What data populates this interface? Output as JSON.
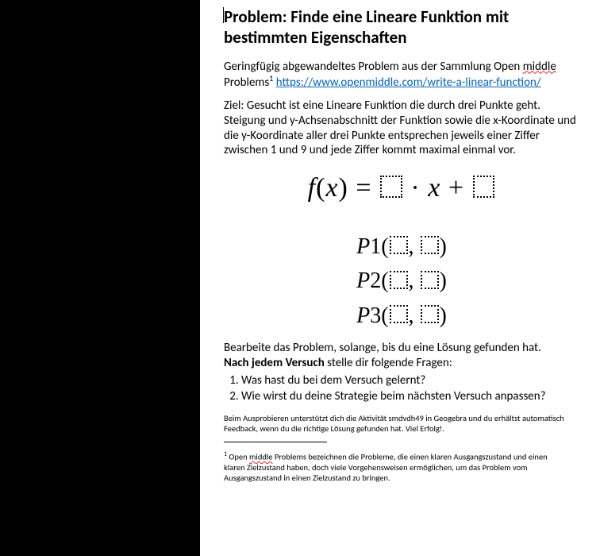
{
  "heading": "Problem: Finde eine Lineare Funktion mit bestimmten Eigenschaften",
  "intro": {
    "pre": "Geringfügig abgewandeltes Problem aus der Sammlung Open ",
    "sqg1": "middle",
    "post1": " Problems",
    "sup": "1",
    "space": " ",
    "url": "https://www.openmiddle.com/write-a-linear-function/"
  },
  "goal": "Ziel: Gesucht ist eine Lineare Funktion die durch drei Punkte geht. Steigung und y-Achsenabschnitt der Funktion sowie die x-Koordinate und die y-Koordinate aller drei Punkte entsprechen jeweils einer Ziffer zwischen 1 und 9  und jede Ziffer kommt maximal einmal vor.",
  "equation": {
    "fx_l": "f",
    "fx_paren_o": "(",
    "fx_x": "x",
    "fx_paren_c": ")",
    "eq": " = ",
    "dot": " · ",
    "x": "x",
    "plus": " + "
  },
  "points": {
    "p1": "P",
    "n1": "1",
    "p2": "P",
    "n2": "2",
    "p3": "P",
    "n3": "3",
    "open": "(",
    "comma": ", ",
    "close": ")"
  },
  "work": {
    "line1": "Bearbeite das Problem, solange, bis du eine Lösung gefunden hat.",
    "bold": "Nach jedem Versuch",
    "line2_rest": " stelle dir folgende Fragen:"
  },
  "questions": [
    "Was hast du bei dem Versuch gelernt?",
    "Wie wirst du deine Strategie beim nächsten Versuch anpassen?"
  ],
  "hint": "Beim Ausprobieren unterstützt dich die Aktivität smdvdh49 in Geogebra und du erhältst automatisch Feedback, wenn du die richtige Lösung gefunden hat. Viel Erfolg!.",
  "footnote": {
    "mark": "1",
    "pre": " Open ",
    "sqg": "middle",
    "rest": " Problems bezeichnen die Probleme, die einen klaren Ausgangszustand und einen klaren Zielzustand haben, doch viele Vorgehensweisen ermöglichen, um das Problem vom Ausgangszustand in einen Zielzustand zu bringen."
  }
}
